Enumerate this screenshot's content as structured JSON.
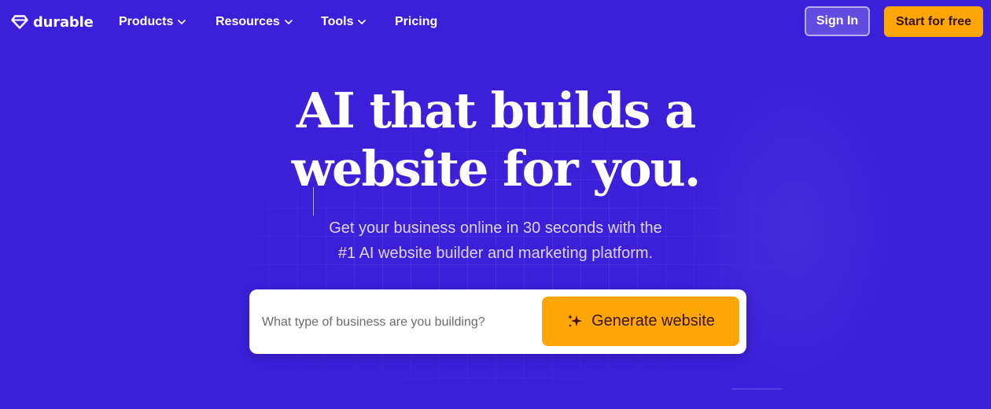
{
  "brand": {
    "name": "durable",
    "icon": "diamond-logo-icon"
  },
  "nav": {
    "items": [
      {
        "label": "Products",
        "has_dropdown": true
      },
      {
        "label": "Resources",
        "has_dropdown": true
      },
      {
        "label": "Tools",
        "has_dropdown": true
      },
      {
        "label": "Pricing",
        "has_dropdown": false
      }
    ],
    "sign_in": "Sign In",
    "start_free": "Start for free"
  },
  "hero": {
    "headline_line1": "AI that builds a",
    "headline_line2": "website for you.",
    "subhead_line1": "Get your business online in 30 seconds with the",
    "subhead_line2": "#1 AI website builder and marketing platform."
  },
  "search": {
    "placeholder": "What type of business are you building?",
    "value": "",
    "button_label": "Generate website",
    "button_icon": "sparkle-icon"
  },
  "colors": {
    "background": "#3b1fd9",
    "accent": "#fda606",
    "accent_text": "#3a1309",
    "text": "#ffffff"
  }
}
